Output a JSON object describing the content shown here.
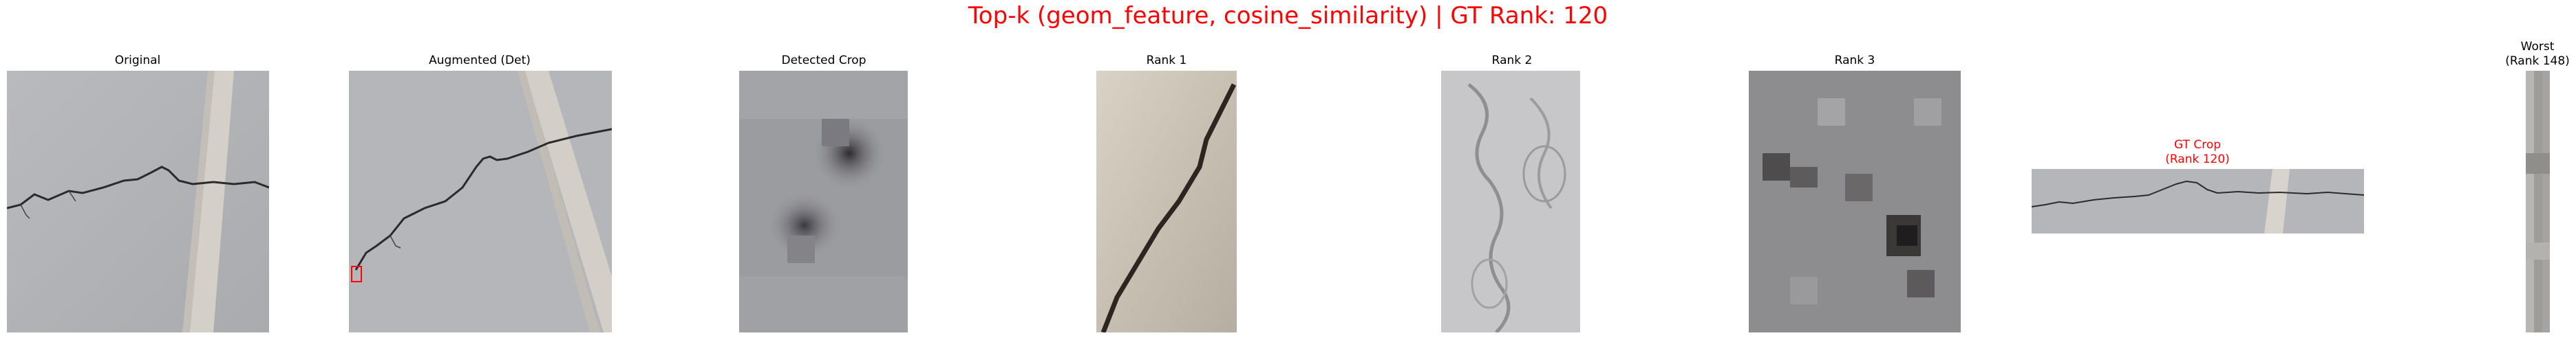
{
  "figure": {
    "title": "Top-k (geom_feature, cosine_similarity) | GT Rank: 120",
    "title_color": "#ff0000"
  },
  "panels": {
    "original": {
      "title": "Original"
    },
    "augmented": {
      "title": "Augmented (Det)",
      "detection_box_color": "#ff0000"
    },
    "detected_crop": {
      "title": "Detected Crop"
    },
    "rank1": {
      "title": "Rank 1"
    },
    "rank2": {
      "title": "Rank 2"
    },
    "rank3": {
      "title": "Rank 3"
    },
    "gt_crop": {
      "title_line1": "GT Crop",
      "title_line2": "(Rank 120)",
      "title_color": "#ff0000"
    },
    "worst": {
      "title_line1": "Worst",
      "title_line2": "(Rank 148)"
    }
  }
}
